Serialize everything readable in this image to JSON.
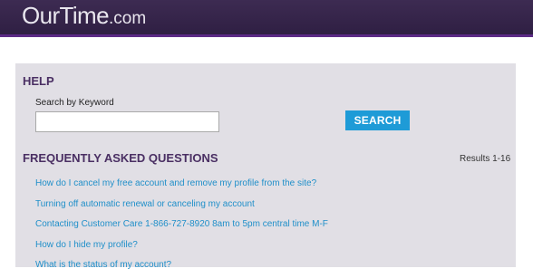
{
  "header": {
    "logo_text": "OurTime",
    "logo_suffix": ".com"
  },
  "help": {
    "title": "HELP",
    "search_label": "Search by Keyword",
    "search_value": "",
    "search_placeholder": "",
    "search_button": "SEARCH"
  },
  "faq": {
    "title": "FREQUENTLY ASKED QUESTIONS",
    "results": "Results 1-16",
    "items": [
      {
        "label": "How do I cancel my free account and remove my profile from the site?"
      },
      {
        "label": "Turning off automatic renewal or canceling my account"
      },
      {
        "label": "Contacting Customer Care 1-866-727-8920 8am to 5pm central time M-F"
      },
      {
        "label": "How do I hide my profile?"
      },
      {
        "label": "What is the status of my account?"
      }
    ]
  },
  "colors": {
    "header_bg": "#2f1f43",
    "accent_line": "#5c2a86",
    "panel_bg": "#e1dfe5",
    "heading": "#4a2f63",
    "link": "#1f8fc9",
    "button": "#1e9bd7"
  }
}
